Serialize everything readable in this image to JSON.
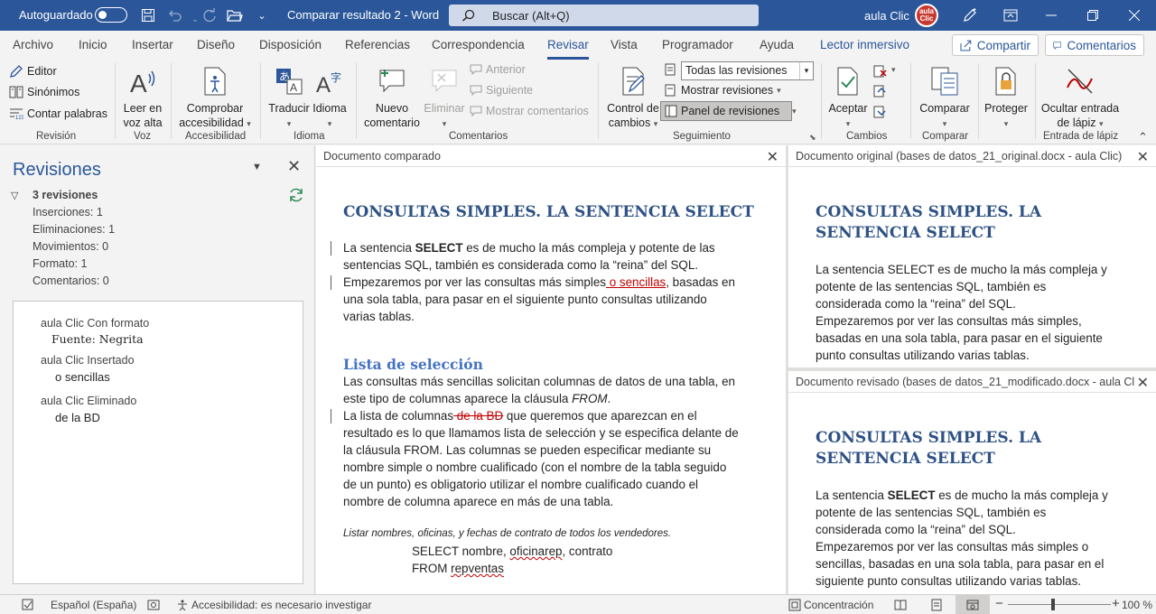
{
  "titlebar": {
    "autosave_label": "Autoguardado",
    "doc_title": "Comparar resultado 2 - Word",
    "search_placeholder": "Buscar (Alt+Q)",
    "user_name": "aula Clic",
    "avatar_text": "aula Clic"
  },
  "tabs": [
    "Archivo",
    "Inicio",
    "Insertar",
    "Diseño",
    "Disposición",
    "Referencias",
    "Correspondencia",
    "Revisar",
    "Vista",
    "Programador",
    "Ayuda",
    "Lector inmersivo"
  ],
  "active_tab": "Revisar",
  "share_label": "Compartir",
  "comments_label": "Comentarios",
  "ribbon": {
    "revision": {
      "editor": "Editor",
      "synonyms": "Sinónimos",
      "wordcount": "Contar palabras",
      "label": "Revisión"
    },
    "voz": {
      "read_aloud": "Leer en voz alta",
      "label": "Voz"
    },
    "accesibilidad": {
      "check": "Comprobar accesibilidad",
      "label": "Accesibilidad"
    },
    "idioma": {
      "translate": "Traducir",
      "language": "Idioma",
      "label": "Idioma"
    },
    "comentarios": {
      "new": "Nuevo comentario",
      "delete": "Eliminar",
      "previous": "Anterior",
      "next": "Siguiente",
      "show": "Mostrar comentarios",
      "label": "Comentarios"
    },
    "seguimiento": {
      "track": "Control de cambios",
      "markup_value": "Todas las revisiones",
      "show_markup": "Mostrar revisiones",
      "pane": "Panel de revisiones",
      "label": "Seguimiento"
    },
    "cambios": {
      "accept": "Aceptar",
      "label": "Cambios"
    },
    "comparar": {
      "compare": "Comparar",
      "label": "Comparar"
    },
    "proteger": {
      "protect": "Proteger"
    },
    "lapiz": {
      "hide_ink": "Ocultar entrada de lápiz",
      "label": "Entrada de lápiz"
    }
  },
  "revisions_pane": {
    "title": "Revisiones",
    "summary": "3 revisiones",
    "stats": [
      "Inserciones: 1",
      "Eliminaciones: 1",
      "Movimientos: 0",
      "Formato: 1",
      "Comentarios: 0"
    ],
    "items": [
      {
        "author": "aula Clic Con formato",
        "detail": "Fuente: Negrita"
      },
      {
        "author": "aula Clic Insertado",
        "detail": "o sencillas"
      },
      {
        "author": "aula Clic Eliminado",
        "detail": "de la BD"
      }
    ]
  },
  "compared": {
    "header": "Documento comparado",
    "heading": "CONSULTAS SIMPLES. LA SENTENCIA SELECT",
    "p1_a": "La sentencia ",
    "p1_bold": "SELECT",
    "p1_b": " es de mucho la más compleja y potente de las sentencias SQL, también es considerada como la “reina” del SQL.",
    "p2_a": "Empezaremos por ver las consultas más simples",
    "p2_ins": " o sencillas",
    "p2_b": ", basadas en una sola tabla, para pasar en el siguiente punto consultas utilizando varias tablas.",
    "subheading": "Lista de selección",
    "p3_a": "Las consultas más sencillas solicitan columnas de datos de una tabla, en este tipo de columnas aparece la cláusula ",
    "p3_i": "FROM",
    "p3_b": ".",
    "p4_a": "La lista de columnas",
    "p4_del": " de la BD",
    "p4_b": " que queremos que aparezcan en el resultado es lo que llamamos lista de selección y se especifica delante de la cláusula FROM. Las columnas se pueden especificar mediante su nombre simple o nombre cualificado (con el nombre de la tabla seguido de un punto) es obligatorio utilizar el nombre cualificado cuando el nombre de columna aparece en más de una tabla.",
    "example_caption": "Listar nombres, oficinas, y fechas de contrato de todos los vendedores.",
    "code1_a": "SELECT nombre, ",
    "code1_err": "oficinarep",
    "code1_b": ", contrato",
    "code2_a": "FROM ",
    "code2_err": "repventas"
  },
  "original": {
    "header": "Documento original (bases de datos_21_original.docx - aula Clic)",
    "heading": "CONSULTAS SIMPLES. LA SENTENCIA SELECT",
    "p1": "La sentencia SELECT es de mucho la más compleja y potente de las sentencias SQL, también es considerada como la “reina” del SQL.",
    "p2": "Empezaremos por ver las consultas más simples, basadas en una sola tabla, para pasar en el siguiente punto consultas utilizando varias tablas."
  },
  "revised": {
    "header": "Documento revisado (bases de datos_21_modificado.docx - aula Cl",
    "heading": "CONSULTAS SIMPLES. LA SENTENCIA SELECT",
    "p1_a": "La sentencia ",
    "p1_bold": "SELECT",
    "p1_b": " es de mucho la más compleja y potente de las sentencias SQL, también es considerada como la “reina” del SQL.",
    "p2": "Empezaremos por ver las consultas más simples o sencillas, basadas en una sola tabla, para pasar en el siguiente punto consultas utilizando varias tablas."
  },
  "status": {
    "language": "Español (España)",
    "accessibility": "Accesibilidad: es necesario investigar",
    "focus": "Concentración",
    "zoom": "100 %"
  },
  "colors": {
    "accent": "#2b579a",
    "revision_red": "#c00000"
  }
}
